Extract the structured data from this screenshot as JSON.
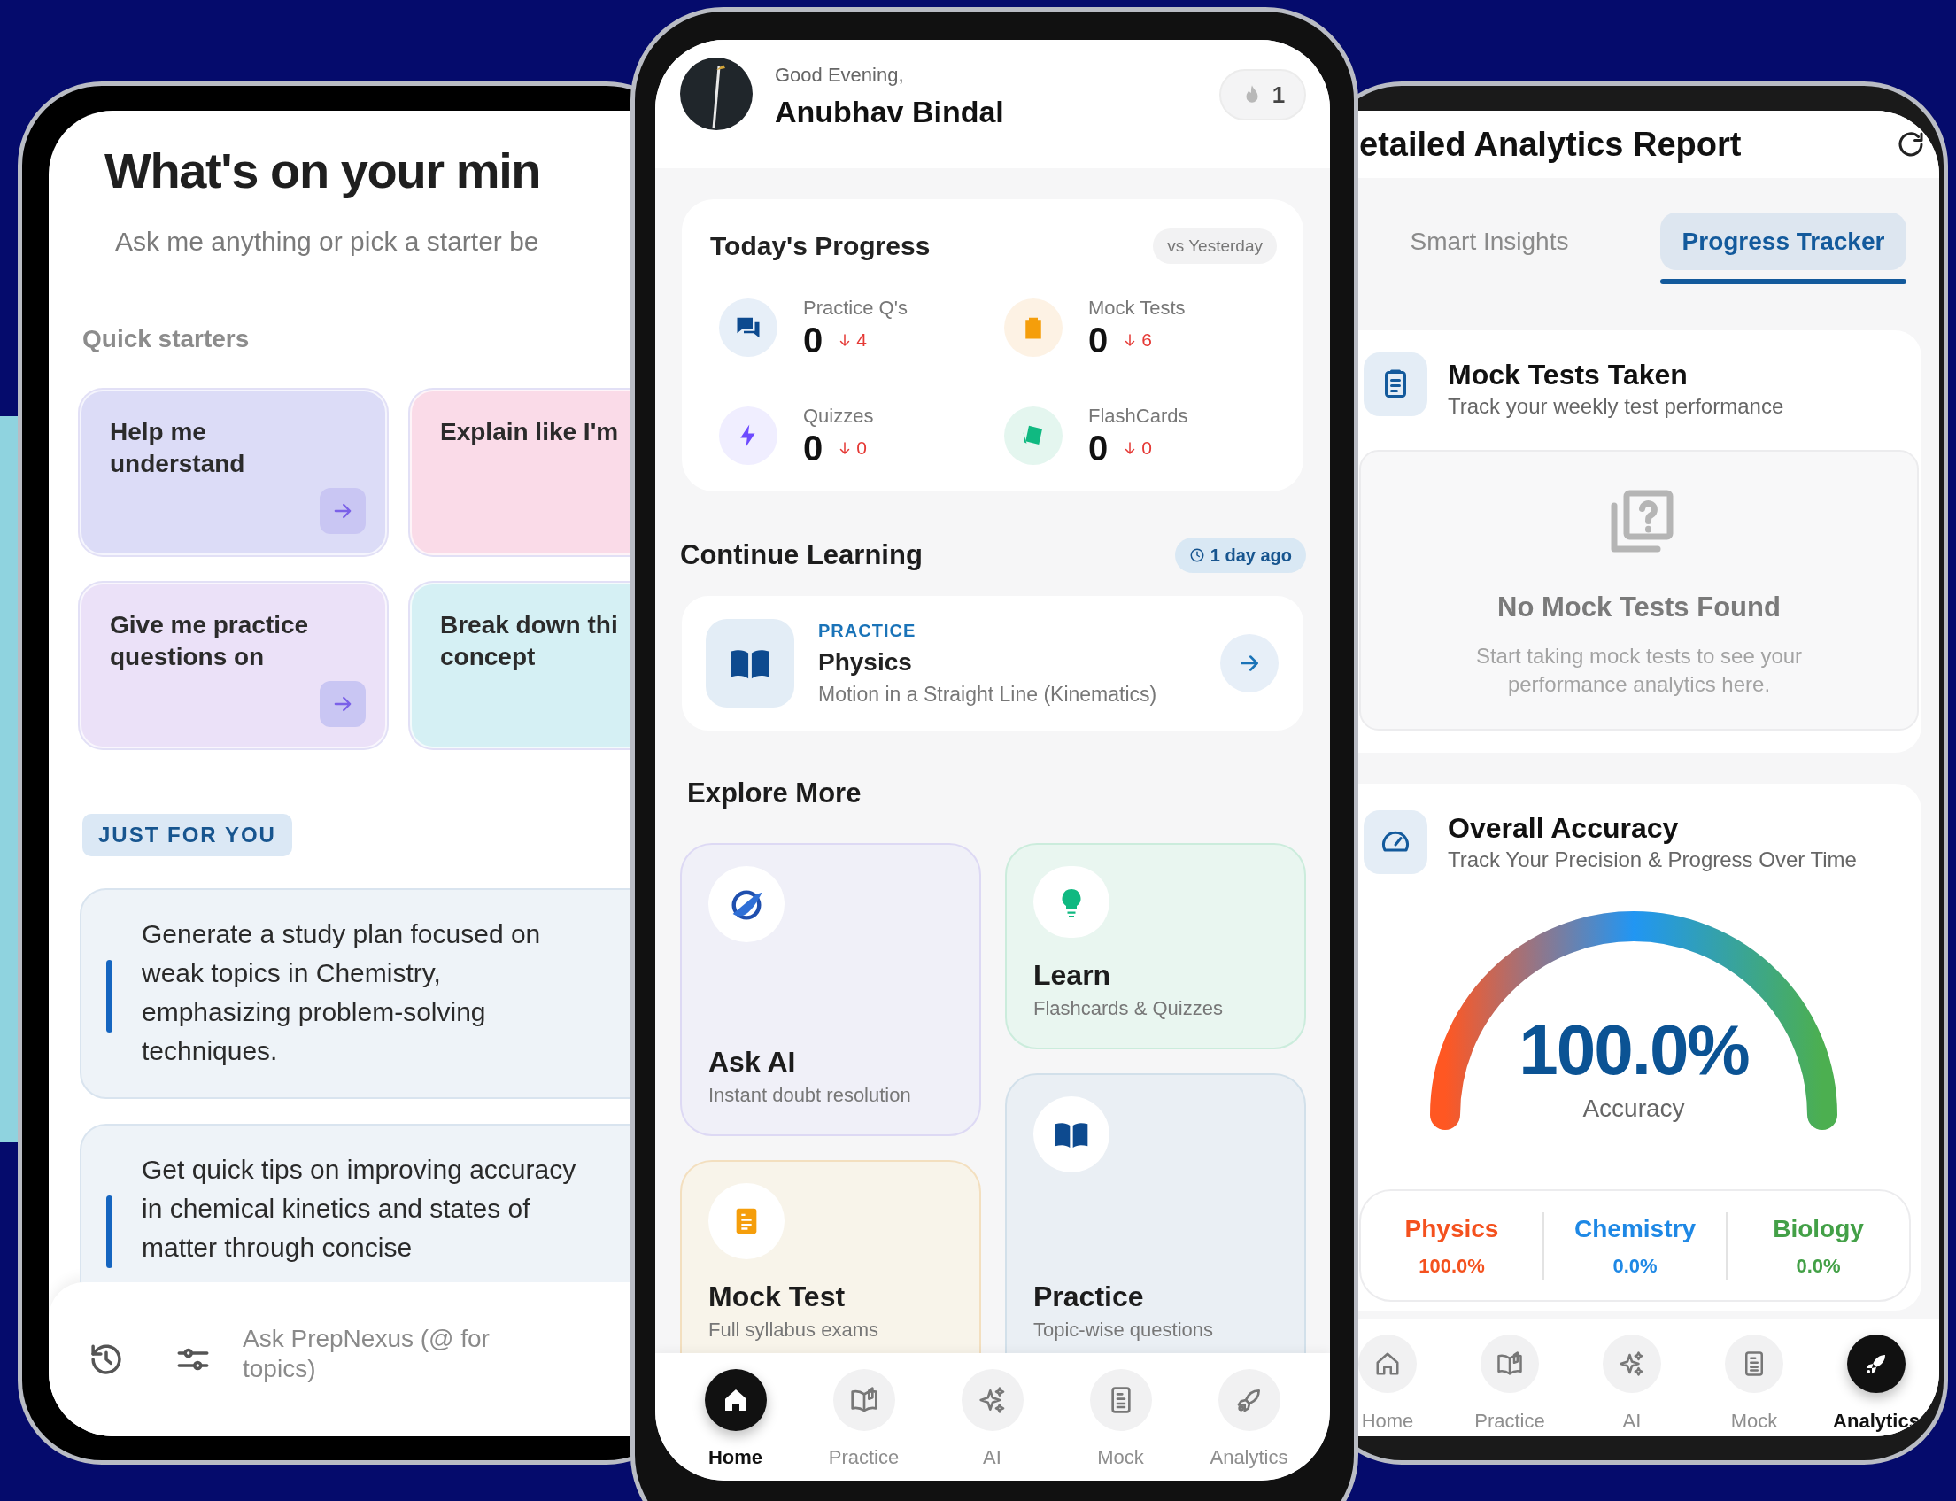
{
  "ask_screen": {
    "title": "What's on your min",
    "subtitle": "Ask me anything or pick a starter be",
    "section_label": "Quick starters",
    "starters": [
      {
        "lines": [
          "Help me",
          "understand"
        ],
        "color": "#dcdcf7",
        "arrow": true
      },
      {
        "lines": [
          "Explain like I'm"
        ],
        "color": "#fadbe8",
        "arrow": false
      },
      {
        "lines": [
          "Give me practice",
          "questions on"
        ],
        "color": "#ebe1f8",
        "arrow": true
      },
      {
        "lines": [
          "Break down thi",
          "concept"
        ],
        "color": "#d5f0f4",
        "arrow": false
      }
    ],
    "badge": "JUST FOR YOU",
    "suggestions": [
      {
        "text": "Generate a study plan focused on weak topics in Chemistry, emphasizing problem-solving techniques."
      },
      {
        "text": "Get quick tips on improving accuracy in chemical kinetics and states of matter through concise"
      }
    ],
    "input": {
      "placeholder": "Ask PrepNexus (@ for topics)"
    }
  },
  "home_screen": {
    "greeting": "Good Evening,",
    "user_name": "Anubhav Bindal",
    "streak": "1",
    "progress": {
      "title": "Today's Progress",
      "compare": "vs Yesterday",
      "stats": [
        {
          "kind": "chat",
          "label": "Practice Q's",
          "value": "0",
          "delta": "4"
        },
        {
          "kind": "clipboard",
          "label": "Mock Tests",
          "value": "0",
          "delta": "6"
        },
        {
          "kind": "bolt",
          "label": "Quizzes",
          "value": "0",
          "delta": "0"
        },
        {
          "kind": "cards",
          "label": "FlashCards",
          "value": "0",
          "delta": "0"
        }
      ]
    },
    "continue": {
      "title": "Continue Learning",
      "time": "1 day ago",
      "item": {
        "category": "PRACTICE",
        "subject": "Physics",
        "topic": "Motion in a Straight Line (Kinematics)"
      }
    },
    "explore": {
      "title": "Explore More",
      "cards": [
        {
          "kind": "ask",
          "title": "Ask AI",
          "subtitle": "Instant doubt resolution"
        },
        {
          "kind": "mock",
          "title": "Mock Test",
          "subtitle": "Full syllabus exams"
        },
        {
          "kind": "learn",
          "title": "Learn",
          "subtitle": "Flashcards & Quizzes"
        },
        {
          "kind": "practice",
          "title": "Practice",
          "subtitle": "Topic-wise questions"
        }
      ]
    },
    "nav": [
      {
        "kind": "home",
        "label": "Home",
        "selected": true
      },
      {
        "kind": "practice",
        "label": "Practice",
        "selected": false
      },
      {
        "kind": "ai",
        "label": "AI",
        "selected": false
      },
      {
        "kind": "mock",
        "label": "Mock",
        "selected": false
      },
      {
        "kind": "analytics",
        "label": "Analytics",
        "selected": false
      }
    ]
  },
  "analytics_screen": {
    "title": "etailed Analytics Report",
    "tabs": [
      {
        "label": "Smart Insights",
        "selected": false
      },
      {
        "label": "Progress Tracker",
        "selected": true
      }
    ],
    "mock_tests": {
      "title": "Mock Tests Taken",
      "subtitle": "Track your weekly test performance",
      "empty_title": "No Mock Tests Found",
      "empty_text": "Start taking mock tests to see your performance analytics here."
    },
    "accuracy": {
      "title": "Overall Accuracy",
      "subtitle": "Track Your Precision & Progress Over Time",
      "value": "100.0%",
      "label": "Accuracy",
      "level": 1,
      "subjects": [
        {
          "name": "Physics",
          "value": "100.0%",
          "color": "#f4511e"
        },
        {
          "name": "Chemistry",
          "value": "0.0%",
          "color": "#1e88e5"
        },
        {
          "name": "Biology",
          "value": "0.0%",
          "color": "#43a047"
        }
      ]
    },
    "nav": [
      {
        "kind": "home",
        "label": "Home",
        "selected": false
      },
      {
        "kind": "practice",
        "label": "Practice",
        "selected": false
      },
      {
        "kind": "ai",
        "label": "AI",
        "selected": false
      },
      {
        "kind": "mock",
        "label": "Mock",
        "selected": false
      },
      {
        "kind": "analytics",
        "label": "Analytics",
        "selected": true
      }
    ]
  }
}
